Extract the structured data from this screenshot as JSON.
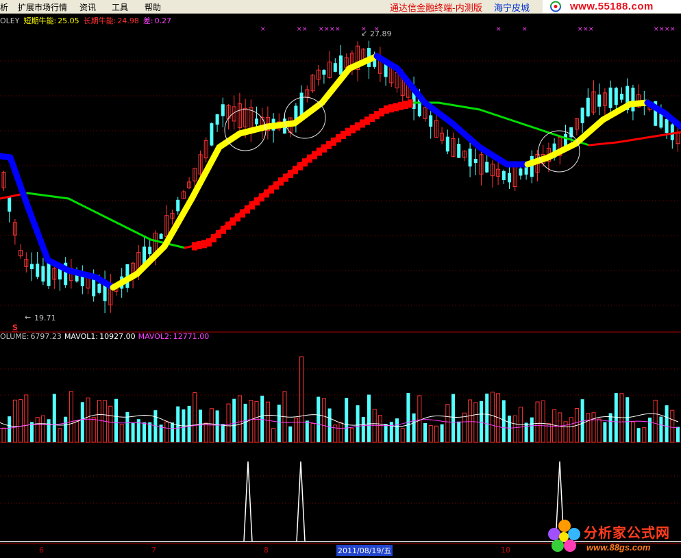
{
  "menu": {
    "items": [
      "析",
      "扩展市场行情",
      "资讯",
      "工具",
      "帮助"
    ]
  },
  "title": {
    "app": "通达信金融终端-内测版",
    "broker": "海宁皮城",
    "url_logo": "www.55188.com"
  },
  "indicator": {
    "name": "OLEY",
    "short_label": "短期牛能:",
    "short_value": "25.05",
    "long_label": "长期牛能:",
    "long_value": "24.98",
    "diff_label": "差:",
    "diff_value": "0.27"
  },
  "annotations": {
    "high_price": "27.89",
    "low_price": "19.71",
    "signal_marker": "S"
  },
  "volume": {
    "volume_label": "OLUME:",
    "volume_value": "6797.23",
    "mavol1_label": "MAVOL1:",
    "mavol1_value": "10927.00",
    "mavol2_label": "MAVOL2:",
    "mavol2_value": "12771.00"
  },
  "xaxis": {
    "ticks": [
      "6",
      "7",
      "8",
      "10"
    ],
    "current_date": "2011/08/19/五"
  },
  "watermark": {
    "name": "分析家公式网",
    "url": "www.88gs.com"
  },
  "colors": {
    "background": "#000000",
    "up_candle": "#ff3333",
    "down_candle": "#54ffff",
    "grid": "#7a0000",
    "short_line_up": "#ffff00",
    "short_line_down": "#0000ff",
    "long_line_up": "#ff0000",
    "long_line_down": "#00dd00",
    "mavol1": "#ffffff",
    "mavol2": "#ff40ff"
  },
  "chart_data": {
    "type": "candlestick",
    "price_range_visible": [
      19.71,
      27.89
    ],
    "volume_indicator": {
      "VOLUME": 6797.23,
      "MAVOL1": 10927.0,
      "MAVOL2": 12771.0
    },
    "bull_energy": {
      "short_term": 25.05,
      "long_term": 24.98,
      "difference": 0.27
    },
    "signal_spikes": 3
  }
}
